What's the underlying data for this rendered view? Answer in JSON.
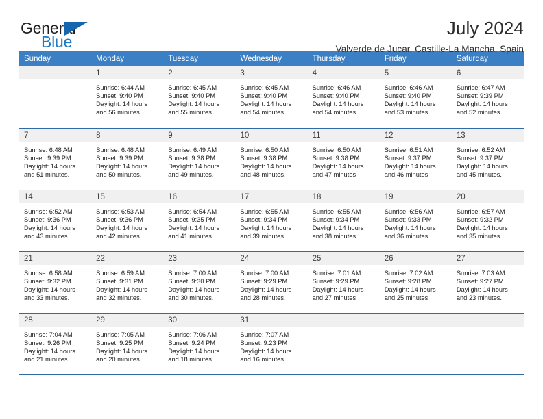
{
  "logo": {
    "general_text": "General",
    "blue_text": "Blue",
    "triangle_color": "#1566ad",
    "blue_color": "#1f7ac4"
  },
  "header": {
    "month_title": "July 2024",
    "location": "Valverde de Jucar, Castille-La Mancha, Spain"
  },
  "theme": {
    "header_bg": "#3b7fc4",
    "rule_color": "#2e6da4",
    "daynum_bg": "#f0f0f0"
  },
  "calendar": {
    "weekday_headers": [
      "Sunday",
      "Monday",
      "Tuesday",
      "Wednesday",
      "Thursday",
      "Friday",
      "Saturday"
    ],
    "weeks": [
      [
        {
          "day": "",
          "empty": true,
          "sunrise": "",
          "sunset": "",
          "daylight_line1": "",
          "daylight_line2": ""
        },
        {
          "day": "1",
          "sunrise": "Sunrise: 6:44 AM",
          "sunset": "Sunset: 9:40 PM",
          "daylight_line1": "Daylight: 14 hours",
          "daylight_line2": "and 56 minutes."
        },
        {
          "day": "2",
          "sunrise": "Sunrise: 6:45 AM",
          "sunset": "Sunset: 9:40 PM",
          "daylight_line1": "Daylight: 14 hours",
          "daylight_line2": "and 55 minutes."
        },
        {
          "day": "3",
          "sunrise": "Sunrise: 6:45 AM",
          "sunset": "Sunset: 9:40 PM",
          "daylight_line1": "Daylight: 14 hours",
          "daylight_line2": "and 54 minutes."
        },
        {
          "day": "4",
          "sunrise": "Sunrise: 6:46 AM",
          "sunset": "Sunset: 9:40 PM",
          "daylight_line1": "Daylight: 14 hours",
          "daylight_line2": "and 54 minutes."
        },
        {
          "day": "5",
          "sunrise": "Sunrise: 6:46 AM",
          "sunset": "Sunset: 9:40 PM",
          "daylight_line1": "Daylight: 14 hours",
          "daylight_line2": "and 53 minutes."
        },
        {
          "day": "6",
          "sunrise": "Sunrise: 6:47 AM",
          "sunset": "Sunset: 9:39 PM",
          "daylight_line1": "Daylight: 14 hours",
          "daylight_line2": "and 52 minutes."
        }
      ],
      [
        {
          "day": "7",
          "sunrise": "Sunrise: 6:48 AM",
          "sunset": "Sunset: 9:39 PM",
          "daylight_line1": "Daylight: 14 hours",
          "daylight_line2": "and 51 minutes."
        },
        {
          "day": "8",
          "sunrise": "Sunrise: 6:48 AM",
          "sunset": "Sunset: 9:39 PM",
          "daylight_line1": "Daylight: 14 hours",
          "daylight_line2": "and 50 minutes."
        },
        {
          "day": "9",
          "sunrise": "Sunrise: 6:49 AM",
          "sunset": "Sunset: 9:38 PM",
          "daylight_line1": "Daylight: 14 hours",
          "daylight_line2": "and 49 minutes."
        },
        {
          "day": "10",
          "sunrise": "Sunrise: 6:50 AM",
          "sunset": "Sunset: 9:38 PM",
          "daylight_line1": "Daylight: 14 hours",
          "daylight_line2": "and 48 minutes."
        },
        {
          "day": "11",
          "sunrise": "Sunrise: 6:50 AM",
          "sunset": "Sunset: 9:38 PM",
          "daylight_line1": "Daylight: 14 hours",
          "daylight_line2": "and 47 minutes."
        },
        {
          "day": "12",
          "sunrise": "Sunrise: 6:51 AM",
          "sunset": "Sunset: 9:37 PM",
          "daylight_line1": "Daylight: 14 hours",
          "daylight_line2": "and 46 minutes."
        },
        {
          "day": "13",
          "sunrise": "Sunrise: 6:52 AM",
          "sunset": "Sunset: 9:37 PM",
          "daylight_line1": "Daylight: 14 hours",
          "daylight_line2": "and 45 minutes."
        }
      ],
      [
        {
          "day": "14",
          "sunrise": "Sunrise: 6:52 AM",
          "sunset": "Sunset: 9:36 PM",
          "daylight_line1": "Daylight: 14 hours",
          "daylight_line2": "and 43 minutes."
        },
        {
          "day": "15",
          "sunrise": "Sunrise: 6:53 AM",
          "sunset": "Sunset: 9:36 PM",
          "daylight_line1": "Daylight: 14 hours",
          "daylight_line2": "and 42 minutes."
        },
        {
          "day": "16",
          "sunrise": "Sunrise: 6:54 AM",
          "sunset": "Sunset: 9:35 PM",
          "daylight_line1": "Daylight: 14 hours",
          "daylight_line2": "and 41 minutes."
        },
        {
          "day": "17",
          "sunrise": "Sunrise: 6:55 AM",
          "sunset": "Sunset: 9:34 PM",
          "daylight_line1": "Daylight: 14 hours",
          "daylight_line2": "and 39 minutes."
        },
        {
          "day": "18",
          "sunrise": "Sunrise: 6:55 AM",
          "sunset": "Sunset: 9:34 PM",
          "daylight_line1": "Daylight: 14 hours",
          "daylight_line2": "and 38 minutes."
        },
        {
          "day": "19",
          "sunrise": "Sunrise: 6:56 AM",
          "sunset": "Sunset: 9:33 PM",
          "daylight_line1": "Daylight: 14 hours",
          "daylight_line2": "and 36 minutes."
        },
        {
          "day": "20",
          "sunrise": "Sunrise: 6:57 AM",
          "sunset": "Sunset: 9:32 PM",
          "daylight_line1": "Daylight: 14 hours",
          "daylight_line2": "and 35 minutes."
        }
      ],
      [
        {
          "day": "21",
          "sunrise": "Sunrise: 6:58 AM",
          "sunset": "Sunset: 9:32 PM",
          "daylight_line1": "Daylight: 14 hours",
          "daylight_line2": "and 33 minutes."
        },
        {
          "day": "22",
          "sunrise": "Sunrise: 6:59 AM",
          "sunset": "Sunset: 9:31 PM",
          "daylight_line1": "Daylight: 14 hours",
          "daylight_line2": "and 32 minutes."
        },
        {
          "day": "23",
          "sunrise": "Sunrise: 7:00 AM",
          "sunset": "Sunset: 9:30 PM",
          "daylight_line1": "Daylight: 14 hours",
          "daylight_line2": "and 30 minutes."
        },
        {
          "day": "24",
          "sunrise": "Sunrise: 7:00 AM",
          "sunset": "Sunset: 9:29 PM",
          "daylight_line1": "Daylight: 14 hours",
          "daylight_line2": "and 28 minutes."
        },
        {
          "day": "25",
          "sunrise": "Sunrise: 7:01 AM",
          "sunset": "Sunset: 9:29 PM",
          "daylight_line1": "Daylight: 14 hours",
          "daylight_line2": "and 27 minutes."
        },
        {
          "day": "26",
          "sunrise": "Sunrise: 7:02 AM",
          "sunset": "Sunset: 9:28 PM",
          "daylight_line1": "Daylight: 14 hours",
          "daylight_line2": "and 25 minutes."
        },
        {
          "day": "27",
          "sunrise": "Sunrise: 7:03 AM",
          "sunset": "Sunset: 9:27 PM",
          "daylight_line1": "Daylight: 14 hours",
          "daylight_line2": "and 23 minutes."
        }
      ],
      [
        {
          "day": "28",
          "sunrise": "Sunrise: 7:04 AM",
          "sunset": "Sunset: 9:26 PM",
          "daylight_line1": "Daylight: 14 hours",
          "daylight_line2": "and 21 minutes."
        },
        {
          "day": "29",
          "sunrise": "Sunrise: 7:05 AM",
          "sunset": "Sunset: 9:25 PM",
          "daylight_line1": "Daylight: 14 hours",
          "daylight_line2": "and 20 minutes."
        },
        {
          "day": "30",
          "sunrise": "Sunrise: 7:06 AM",
          "sunset": "Sunset: 9:24 PM",
          "daylight_line1": "Daylight: 14 hours",
          "daylight_line2": "and 18 minutes."
        },
        {
          "day": "31",
          "sunrise": "Sunrise: 7:07 AM",
          "sunset": "Sunset: 9:23 PM",
          "daylight_line1": "Daylight: 14 hours",
          "daylight_line2": "and 16 minutes."
        },
        {
          "day": "",
          "empty": true,
          "sunrise": "",
          "sunset": "",
          "daylight_line1": "",
          "daylight_line2": ""
        },
        {
          "day": "",
          "empty": true,
          "sunrise": "",
          "sunset": "",
          "daylight_line1": "",
          "daylight_line2": ""
        },
        {
          "day": "",
          "empty": true,
          "sunrise": "",
          "sunset": "",
          "daylight_line1": "",
          "daylight_line2": ""
        }
      ]
    ]
  }
}
